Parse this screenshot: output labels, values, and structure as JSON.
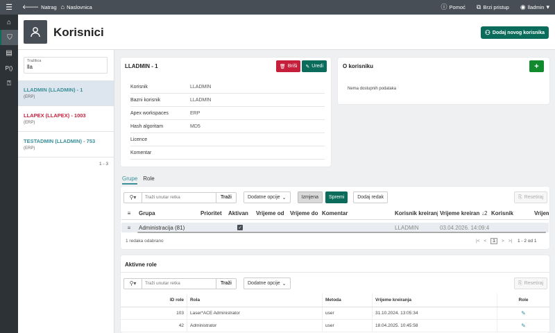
{
  "topbar": {
    "back_label": "Natrag",
    "home_label": "Naslovnica",
    "help_label": "Pomoć",
    "quick_label": "Brzi pristup",
    "user_label": "lladmin"
  },
  "header": {
    "title": "Korisnici",
    "new_user_label": "Dodaj novog korisnika"
  },
  "search": {
    "label": "Tražilica",
    "value": "lla"
  },
  "users": [
    {
      "title": "LLADMIN (LLADMIN) - 1",
      "sub": "(ERP)",
      "color": "#3a8f99"
    },
    {
      "title": "LLAPEX (LLAPEX) - 1003",
      "sub": "(ERP)",
      "color": "#c51f3c"
    },
    {
      "title": "TESTADMIN (LLADMIN) - 753",
      "sub": "(ERP)",
      "color": "#3a8f99"
    }
  ],
  "users_pager": "1 - 3",
  "detail": {
    "title": "LLADMIN - 1",
    "delete_label": "Briši",
    "edit_label": "Uredi",
    "rows": [
      {
        "k": "Korisnik",
        "v": "LLADMIN"
      },
      {
        "k": "Bazni korisnik",
        "v": "LLADMIN"
      },
      {
        "k": "Apex workspaces",
        "v": "ERP"
      },
      {
        "k": "Hash algoritam",
        "v": "MD5"
      },
      {
        "k": "Licence",
        "v": ""
      },
      {
        "k": "Komentar",
        "v": ""
      }
    ]
  },
  "about": {
    "title": "O korisniku",
    "add_label": "+",
    "empty": "Nema dostupnih podataka"
  },
  "tabs": [
    "Grupe",
    "Role"
  ],
  "groups": {
    "search_placeholder": "Traži unutar retka",
    "search_go": "Traži",
    "more_options": "Dodatne opcije",
    "changes_label": "Izmjena",
    "save_label": "Spremi",
    "add_row_label": "Dodaj redak",
    "reset_label": "Resetiraj",
    "columns": [
      "Grupa",
      "Prioritet",
      "Aktivan",
      "Vrijeme od",
      "Vrijeme do",
      "Komentar",
      "Korisnik kreiranja",
      "Vrijeme kreiranja",
      "Korisnik",
      "Vrijem"
    ],
    "sort_mark": "2",
    "row": {
      "grupa": "Administracija (81)",
      "korisnik_kreiranja": "LLADMIN",
      "vrijeme_kreiranja": "03.04.2026. 14:09:40"
    },
    "selected_text": "1 redaka odabrano",
    "page": "1",
    "range": "1 - 2 od 1"
  },
  "roles": {
    "title": "Aktivne role",
    "search_placeholder": "Traži unutar retka",
    "search_go": "Traži",
    "more_options": "Dodatne opcije",
    "reset_label": "Resetiraj",
    "columns": [
      "ID role",
      "Rola",
      "Metoda",
      "Vrijeme kreiranja",
      "Role"
    ],
    "rows": [
      {
        "id": "103",
        "rola": "Laser*ACE Administrator",
        "metoda": "user",
        "vrijeme": "31.10.2024. 13:05:34"
      },
      {
        "id": "42",
        "rola": "Administrator",
        "metoda": "user",
        "vrijeme": "18.04.2025. 10:45:58"
      }
    ]
  },
  "colors": {
    "brand": "#0c6c5c",
    "danger": "#c51f3c",
    "link": "#3a8f99",
    "topbar": "#474e55"
  }
}
